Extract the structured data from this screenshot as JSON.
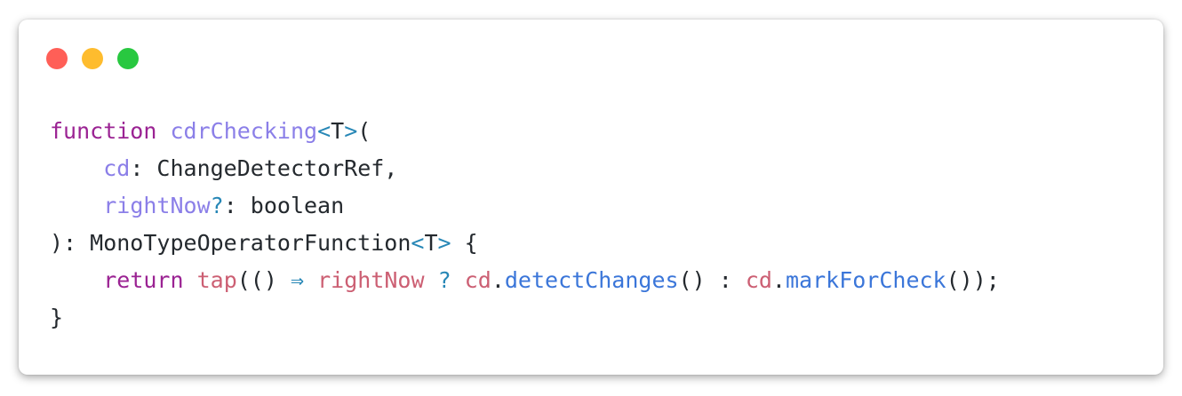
{
  "window": {
    "controls": [
      "close",
      "minimize",
      "maximize"
    ],
    "colors": {
      "close": "#ff5f57",
      "minimize": "#febc2e",
      "maximize": "#28c840"
    }
  },
  "code": {
    "line1": {
      "kw": "function",
      "sp": " ",
      "fn": "cdrChecking",
      "lt": "<",
      "T": "T",
      "gt": ">",
      "paren": "("
    },
    "line2": {
      "indent": "    ",
      "param": "cd",
      "rest": ": ChangeDetectorRef,"
    },
    "line3": {
      "indent": "    ",
      "param": "rightNow",
      "q": "?",
      "rest": ": boolean"
    },
    "line4": {
      "start": "): MonoTypeOperatorFunction",
      "lt": "<",
      "T": "T",
      "gt": ">",
      "rest": " {"
    },
    "line5": {
      "indent": "    ",
      "kw": "return",
      "sp1": " ",
      "fn": "tap",
      "p1": "(() ",
      "arrow": "⇒",
      "sp2": " ",
      "v1": "rightNow",
      "sp3": " ",
      "q": "?",
      "sp4": " ",
      "v2": "cd",
      "dot1": ".",
      "m1": "detectChanges",
      "p2": "() : ",
      "v3": "cd",
      "dot2": ".",
      "m2": "markForCheck",
      "p3": "());"
    },
    "line6": {
      "text": "}"
    }
  }
}
